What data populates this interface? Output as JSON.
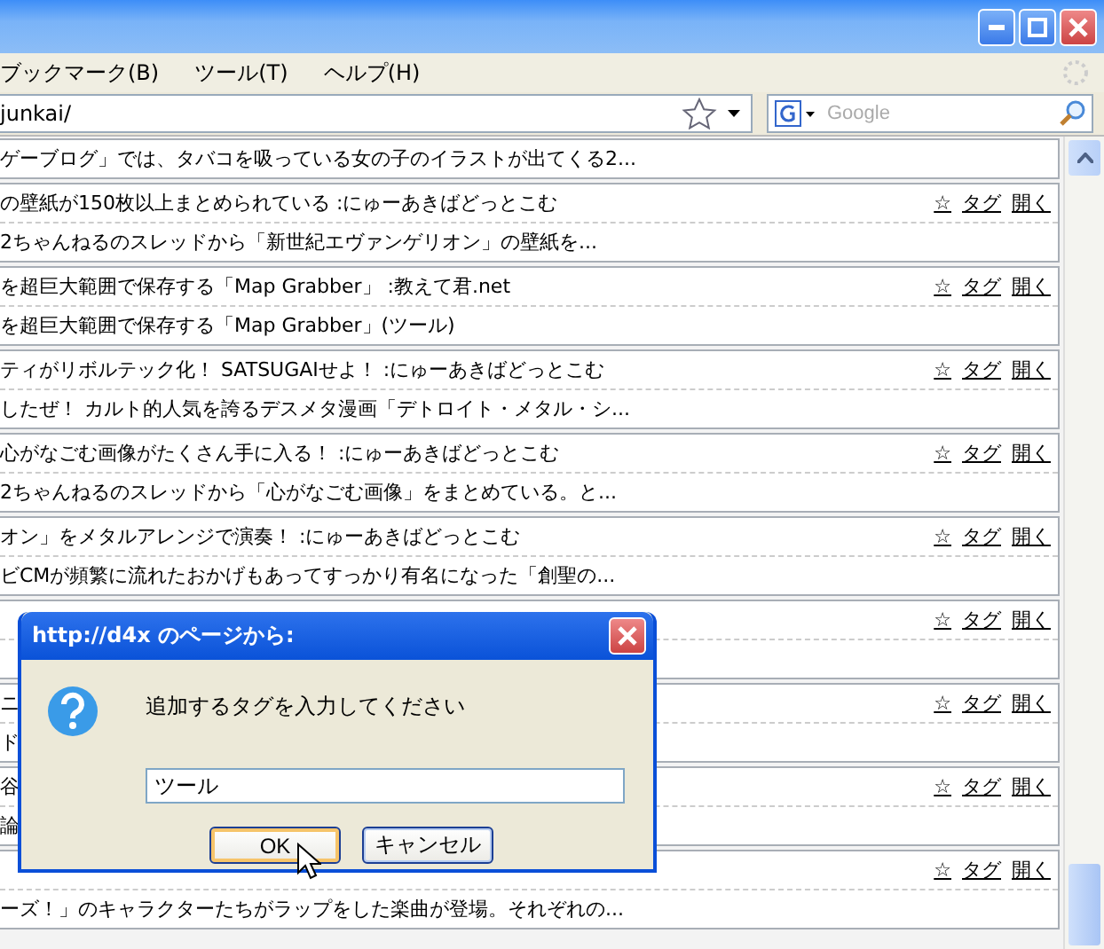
{
  "menu": [
    {
      "label": "ブックマーク(B)"
    },
    {
      "label": "ツール(T)"
    },
    {
      "label": "ヘルプ(H)"
    }
  ],
  "address": {
    "value": "junkai/"
  },
  "search": {
    "placeholder": "Google"
  },
  "entries": [
    {
      "description": "ゲーブログ」では、タバコを吸っている女の子のイラストが出てくる2..."
    },
    {
      "title": "の壁紙が150枚以上まとめられている :にゅーあきばどっとこむ",
      "description": "2ちゃんねるのスレッドから「新世紀エヴァンゲリオン」の壁紙を...",
      "actions": [
        "☆",
        "タグ",
        "開く"
      ]
    },
    {
      "title": "を超巨大範囲で保存する「Map Grabber」 :教えて君.net",
      "description": "を超巨大範囲で保存する「Map Grabber」(ツール)",
      "actions": [
        "☆",
        "タグ",
        "開く"
      ]
    },
    {
      "title": "ティがリボルテック化！ SATSUGAIせよ！ :にゅーあきばどっとこむ",
      "description": "したぜ！ カルト的人気を誇るデスメタ漫画「デトロイト・メタル・シ...",
      "actions": [
        "☆",
        "タグ",
        "開く"
      ]
    },
    {
      "title": "心がなごむ画像がたくさん手に入る！ :にゅーあきばどっとこむ",
      "description": "2ちゃんねるのスレッドから「心がなごむ画像」をまとめている。と...",
      "actions": [
        "☆",
        "タグ",
        "開く"
      ]
    },
    {
      "title": "オン」をメタルアレンジで演奏！ :にゅーあきばどっとこむ",
      "description": "ビCMが頻繁に流れたおかげもあってすっかり有名になった「創聖の...",
      "actions": [
        "☆",
        "タグ",
        "開く"
      ]
    },
    {
      "actions": [
        "☆",
        "タグ",
        "開く"
      ]
    },
    {
      "title": "ニ",
      "description": "ド",
      "actions": [
        "☆",
        "タグ",
        "開く"
      ]
    },
    {
      "title": "谷",
      "description": "論",
      "actions": [
        "☆",
        "タグ",
        "開く"
      ]
    },
    {
      "description": "ーズ！」のキャラクターたちがラップをした楽曲が登場。それぞれの...",
      "actions": [
        "☆",
        "タグ",
        "開く"
      ]
    }
  ],
  "dialog": {
    "title": "http://d4x のページから:",
    "message": "追加するタグを入力してください",
    "input": "ツール",
    "buttons": [
      {
        "label": "OK",
        "selected": true
      },
      {
        "label": "キャンセル",
        "selected": false
      }
    ]
  }
}
